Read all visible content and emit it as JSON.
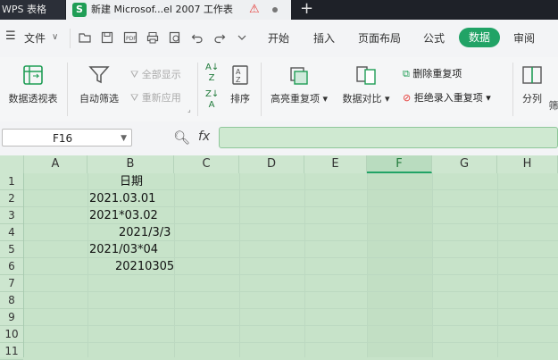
{
  "titlebar": {
    "app_tab": "WPS 表格",
    "doc_tab_icon": "S",
    "doc_tab": "新建 Microsof...el 2007 工作表",
    "warn_glyph": "⚠",
    "plus": "+"
  },
  "menubar": {
    "hamburger": "☰",
    "file": "文件",
    "file_caret": "∨",
    "tabs": [
      "开始",
      "插入",
      "页面布局",
      "公式",
      "数据",
      "审阅"
    ],
    "active_tab": "数据"
  },
  "ribbon": {
    "pivot": "数据透视表",
    "autofilter": "自动筛选",
    "show_all": "全部显示",
    "reapply": "重新应用",
    "sort": "排序",
    "highlight_dup": "高亮重复项",
    "compare": "数据对比",
    "remove_dup": "删除重复项",
    "reject_dup": "拒绝录入重复项",
    "split": "分列",
    "filter_more": "筛"
  },
  "formula_bar": {
    "name_box": "F16",
    "fx": "fx",
    "value": ""
  },
  "grid": {
    "columns": [
      "A",
      "B",
      "C",
      "D",
      "E",
      "F",
      "G",
      "H"
    ],
    "active_column": "F",
    "rows": [
      "1",
      "2",
      "3",
      "4",
      "5",
      "6",
      "7",
      "8",
      "9",
      "10",
      "11"
    ],
    "cells": {
      "B1": "日期",
      "B2": "2021.03.01",
      "B3": "2021*03.02",
      "B4": "2021/3/3",
      "B5": "2021/03*04",
      "B6": "20210305"
    }
  }
}
